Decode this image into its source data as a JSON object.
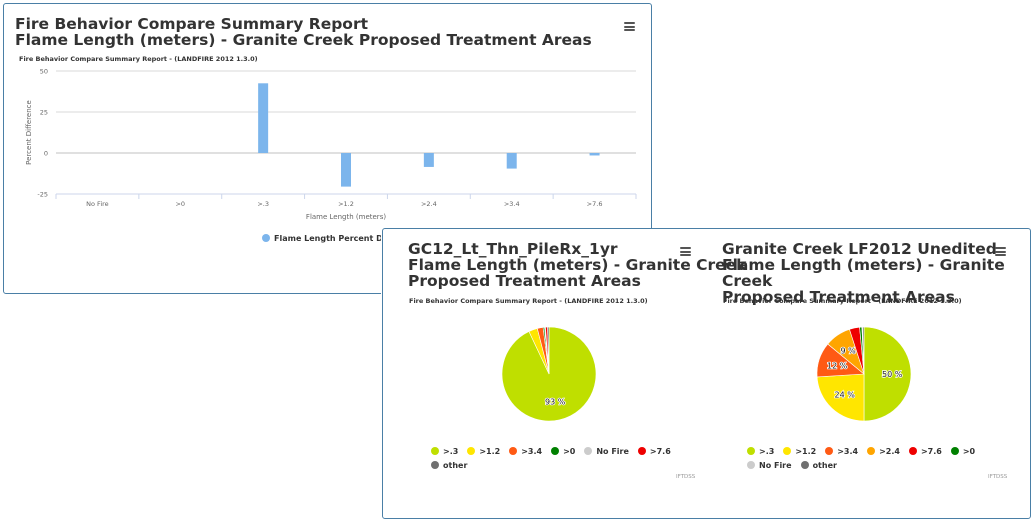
{
  "chart_data": [
    {
      "type": "bar",
      "title": "Fire Behavior Compare Summary Report\nFlame Length (meters) - Granite Creek Proposed Treatment Areas",
      "subtitle": "Fire Behavior Compare Summary Report - (LANDFIRE 2012 1.3.0)",
      "xlabel": "Flame Length (meters)",
      "ylabel": "Percent Difference",
      "ylim": [
        -25,
        50
      ],
      "yticks": [
        "50",
        "25",
        "0",
        "-25"
      ],
      "categories": [
        "No Fire",
        ">0",
        ">.3",
        ">1.2",
        ">2.4",
        ">3.4",
        ">7.6"
      ],
      "series": [
        {
          "name": "Flame Length Percent Differe",
          "color": "#7cb5ec",
          "values": [
            0,
            0,
            42.5,
            -20.5,
            -8.5,
            -9.5,
            -1.5
          ]
        }
      ],
      "grid": true,
      "legend": "bottom-center"
    },
    {
      "type": "pie",
      "title": "GC12_Lt_Thn_PileRx_1yr\nFlame Length (meters) - Granite Creek\nProposed Treatment Areas",
      "subtitle": "Fire Behavior Compare Summary Report - (LANDFIRE 2012 1.3.0)",
      "credits": "IFTDSS",
      "legend": "bottom",
      "slices": [
        {
          "label": ">.3",
          "value": 93,
          "color": "#bfdf00",
          "data_label": "93 %"
        },
        {
          "label": ">1.2",
          "value": 3,
          "color": "#ffe600",
          "data_label": ""
        },
        {
          "label": ">3.4",
          "value": 2,
          "color": "#ff5a14",
          "data_label": ""
        },
        {
          "label": ">0",
          "value": 0.5,
          "color": "#008000",
          "data_label": ""
        },
        {
          "label": "No Fire",
          "value": 0.3,
          "color": "#cccccc",
          "data_label": ""
        },
        {
          "label": ">7.6",
          "value": 0.7,
          "color": "#ee0000",
          "data_label": ""
        },
        {
          "label": "other",
          "value": 0.5,
          "color": "#707070",
          "data_label": ""
        }
      ]
    },
    {
      "type": "pie",
      "title": "Granite Creek LF2012 Unedited\nFlame Length (meters) - Granite Creek\nProposed Treatment Areas",
      "subtitle": "Fire Behavior Compare Summary Report - (LANDFIRE 2012 1.3.0)",
      "credits": "IFTDSS",
      "legend": "bottom",
      "slices": [
        {
          "label": ">.3",
          "value": 50,
          "color": "#bfdf00",
          "data_label": "50 %"
        },
        {
          "label": ">1.2",
          "value": 24,
          "color": "#ffe600",
          "data_label": "24 %"
        },
        {
          "label": ">3.4",
          "value": 12,
          "color": "#ff5a14",
          "data_label": "12 %"
        },
        {
          "label": ">2.4",
          "value": 9,
          "color": "#ffa500",
          "data_label": "9 %"
        },
        {
          "label": ">7.6",
          "value": 3.5,
          "color": "#ee0000",
          "data_label": ""
        },
        {
          "label": ">0",
          "value": 0.8,
          "color": "#008000",
          "data_label": ""
        },
        {
          "label": "No Fire",
          "value": 0.2,
          "color": "#cccccc",
          "data_label": ""
        },
        {
          "label": "other",
          "value": 0.5,
          "color": "#707070",
          "data_label": ""
        }
      ]
    }
  ]
}
